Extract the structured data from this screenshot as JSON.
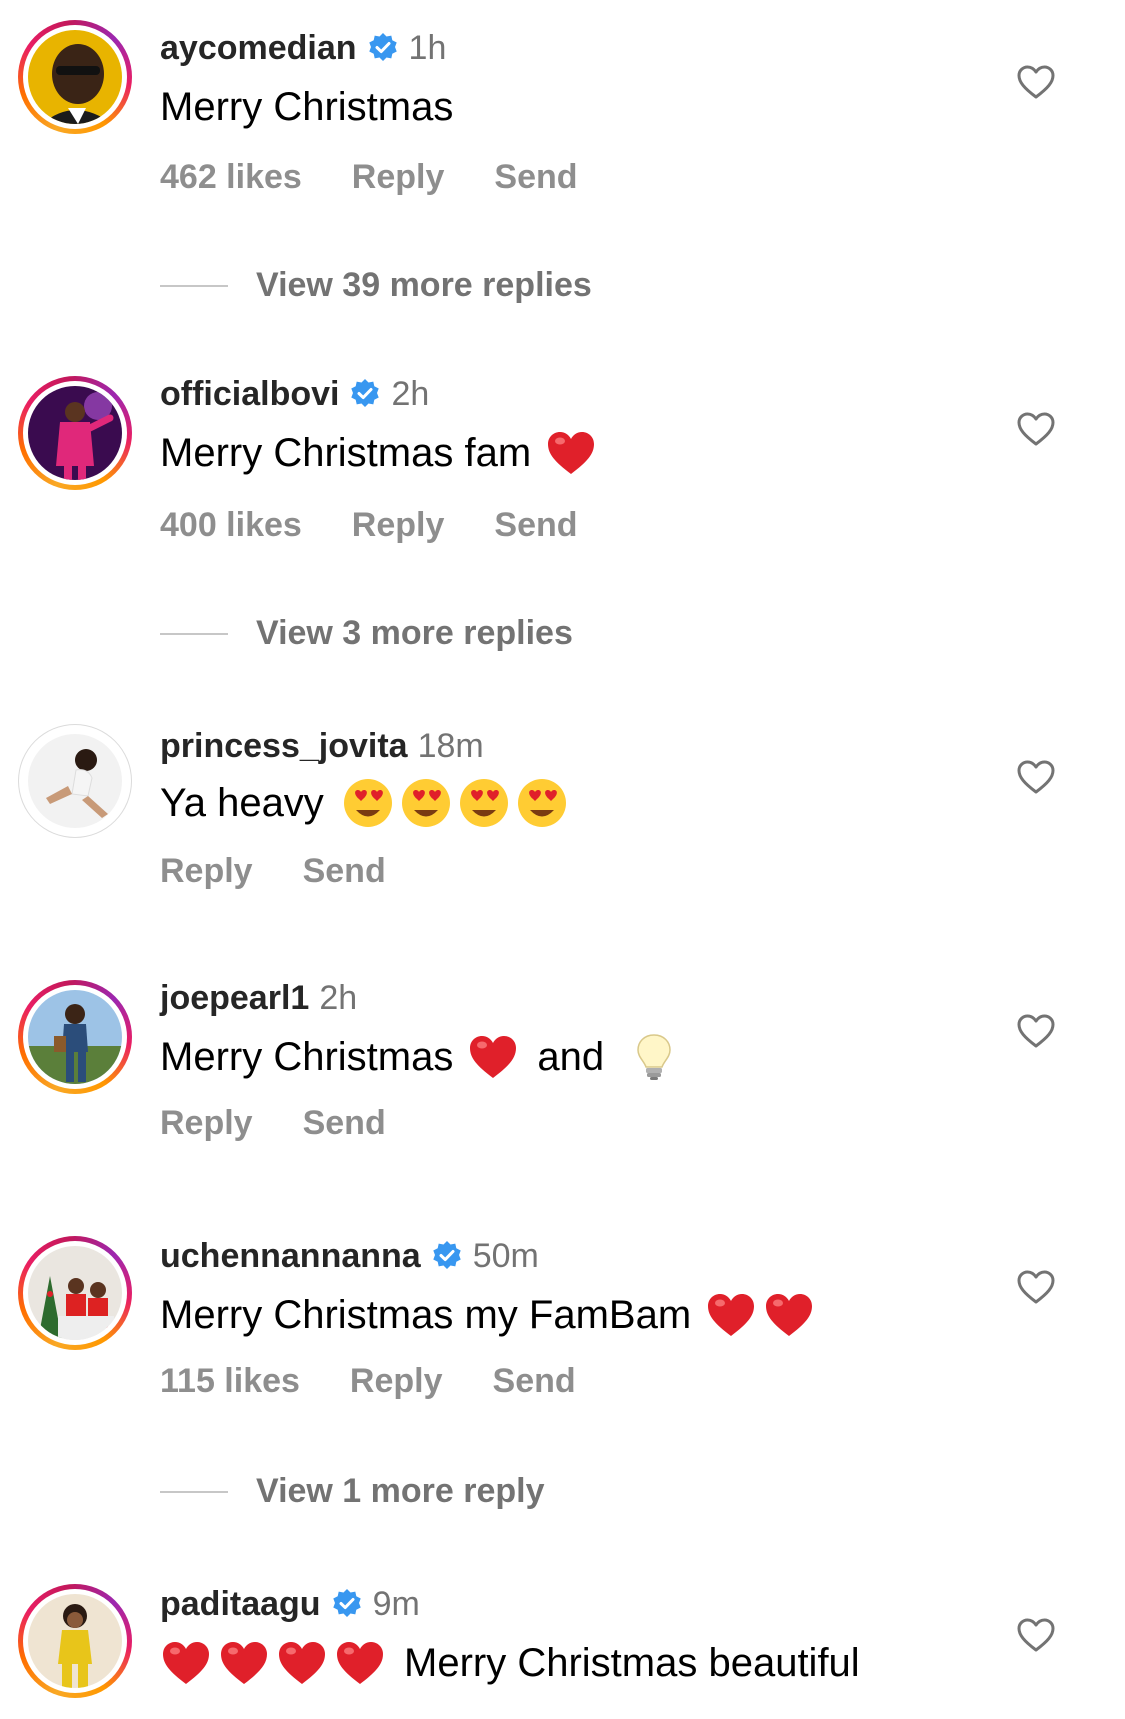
{
  "comments": [
    {
      "username": "aycomedian",
      "verified": true,
      "time": "1h",
      "text": "Merry Christmas",
      "likes": "462 likes",
      "reply": "Reply",
      "send": "Send",
      "view_replies": "View 39 more replies",
      "avatar_ring": true
    },
    {
      "username": "officialbovi",
      "verified": true,
      "time": "2h",
      "text": "Merry Christmas fam",
      "emojis": [
        "red-heart"
      ],
      "likes": "400 likes",
      "reply": "Reply",
      "send": "Send",
      "view_replies": "View 3 more replies",
      "avatar_ring": true
    },
    {
      "username": "princess_jovita",
      "verified": false,
      "time": "18m",
      "text": "Ya heavy",
      "emojis": [
        "heart-eyes",
        "heart-eyes",
        "heart-eyes",
        "heart-eyes"
      ],
      "reply": "Reply",
      "send": "Send",
      "avatar_ring": false
    },
    {
      "username": "joepearl1",
      "verified": false,
      "time": "2h",
      "text": "Merry Christmas",
      "text_after": "and",
      "emojis": [
        "red-heart",
        "light-bulb"
      ],
      "reply": "Reply",
      "send": "Send",
      "avatar_ring": true
    },
    {
      "username": "uchennannanna",
      "verified": true,
      "time": "50m",
      "text": "Merry Christmas my FamBam",
      "emojis": [
        "red-heart",
        "red-heart"
      ],
      "likes": "115 likes",
      "reply": "Reply",
      "send": "Send",
      "view_replies": "View 1 more reply",
      "avatar_ring": true
    },
    {
      "username": "paditaagu",
      "verified": true,
      "time": "9m",
      "text": "Merry Christmas beautiful",
      "emojis": [
        "red-heart",
        "red-heart",
        "red-heart",
        "red-heart"
      ],
      "avatar_ring": true
    }
  ],
  "colors": {
    "username": "#262626",
    "secondary": "#8e8e8e",
    "verified_blue": "#3897f0",
    "heart_red": "#e0202a"
  },
  "icons": {
    "verified": "verified-badge-icon",
    "like": "heart-outline-icon"
  }
}
